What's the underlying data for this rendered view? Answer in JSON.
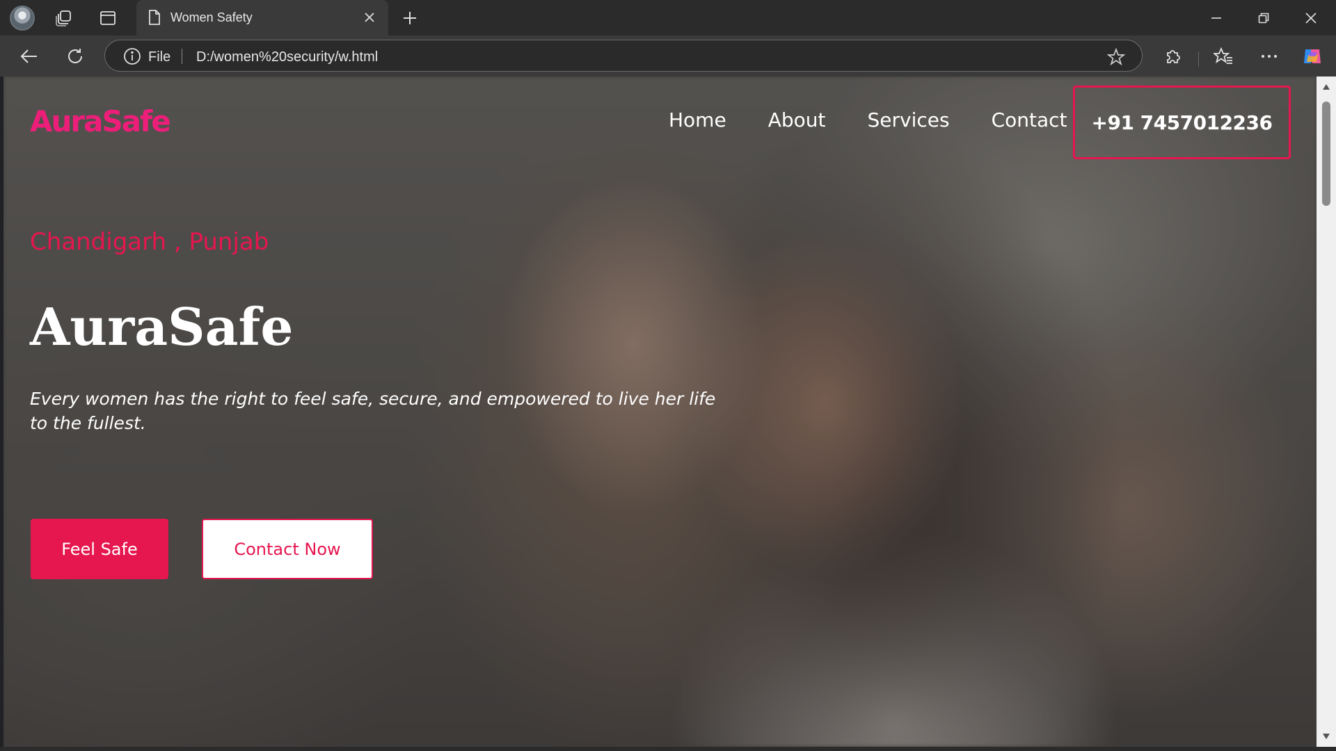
{
  "browser": {
    "tab": {
      "title": "Women Safety"
    },
    "address_bar": {
      "scheme_label": "File",
      "url": "D:/women%20security/w.html"
    },
    "icons": {
      "profile": "profile-avatar",
      "workspaces": "workspaces-icon",
      "tab_actions": "vertical-tabs-icon",
      "page": "page-icon",
      "close_tab": "close-icon",
      "new_tab": "plus-icon",
      "back": "back-arrow-icon",
      "refresh": "refresh-icon",
      "site_info": "info-icon",
      "favorite": "star-icon",
      "extensions": "puzzle-icon",
      "favorites": "favorites-icon",
      "more": "more-icon",
      "copilot": "copilot-icon"
    }
  },
  "site": {
    "brand": "AuraSafe",
    "nav": [
      {
        "label": "Home"
      },
      {
        "label": "About"
      },
      {
        "label": "Services"
      },
      {
        "label": "Contact"
      }
    ],
    "phone": "+91 7457012236"
  },
  "hero": {
    "location": "Chandigarh , Punjab",
    "title": "AuraSafe",
    "tagline": "Every women has the right to feel safe, secure, and empowered to live her life to the fullest.",
    "primary_button": "Feel Safe",
    "secondary_button": "Contact Now"
  },
  "colors": {
    "brand_pink": "#ed1e79",
    "accent_red": "#e6164f",
    "text_white": "#ffffff"
  }
}
